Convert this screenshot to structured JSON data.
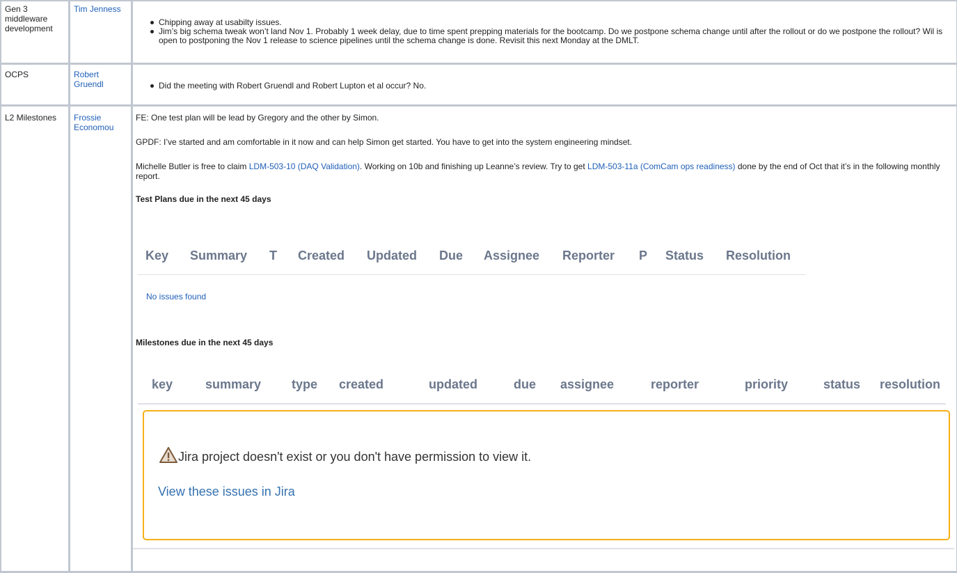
{
  "rows": [
    {
      "topic": "Gen 3 middleware development",
      "owner": "Tim Jenness",
      "bullets": [
        "Chipping away at usabilty issues.",
        "Jim’s big schema tweak won’t land Nov 1. Probably 1 week delay, due to time spent prepping materials for the bootcamp.   Do we postpone schema change until after the rollout or do we postpone the rollout?  Wil is open to postponing the Nov 1 release to science pipelines until the schema change is done.  Revisit this next Monday at the DMLT."
      ]
    },
    {
      "topic": "OCPS",
      "owner": "Robert Gruendl",
      "bullets": [
        "Did the meeting with Robert Gruendl and Robert Lupton et al occur? No."
      ]
    },
    {
      "topic": "L2 Milestones",
      "owner": "Frossie Economou",
      "para1": "FE: One test plan will be lead by Gregory and the other by Simon.",
      "para2": "GPDF: I’ve started and am comfortable in it now and can help Simon get started. You have to get into the system engineering mindset.",
      "para3_a": "Michelle Butler is free to claim ",
      "para3_link1": "LDM-503-10 (DAQ Validation)",
      "para3_b": ". Working on 10b and finishing up Leanne’s review.  Try to get ",
      "para3_link2": "LDM-503-11a (ComCam ops readiness)",
      "para3_c": " done by the end of Oct that it’s in the following monthly report.",
      "test_plans_heading": "Test Plans due in the next 45 days",
      "test_plans_columns": [
        "Key",
        "Summary",
        "T",
        "Created",
        "Updated",
        "Due",
        "Assignee",
        "Reporter",
        "P",
        "Status",
        "Resolution"
      ],
      "no_issues": "No issues found",
      "milestones_heading": "Milestones due in the next 45 days",
      "milestones_columns": [
        "key",
        "summary",
        "type",
        "created",
        "updated",
        "due",
        "assignee",
        "reporter",
        "priority",
        "status",
        "resolution"
      ],
      "warning_text": "Jira project doesn't exist or you don't have permission to view it.",
      "view_link": "View these issues in Jira"
    }
  ],
  "colors": {
    "link": "#1f5fb8",
    "warning_border": "#f6b017",
    "header_gray": "#6b778c"
  },
  "icons": {
    "warning": "warning-triangle-icon"
  }
}
